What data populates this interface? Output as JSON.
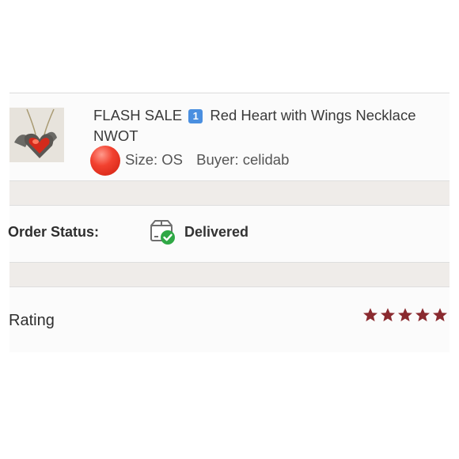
{
  "listing": {
    "title": "FLASH SALE",
    "number_badge": "1",
    "title_rest": "Red Heart with Wings Necklace NWOT",
    "size": "Size: OS",
    "buyer": "Buyer: celidab",
    "thumbnail_icon": "necklace-photo",
    "dot_color": "#e8332a"
  },
  "order_status": {
    "label": "Order Status:",
    "value": "Delivered",
    "icon": "package-delivered-icon",
    "check_color": "#2fa845"
  },
  "rating": {
    "label": "Rating",
    "stars": 5,
    "max_stars": 5,
    "star_color": "#8a2a2f"
  },
  "colors": {
    "separator": "#efece9",
    "card_background": "#fbfbfb"
  }
}
